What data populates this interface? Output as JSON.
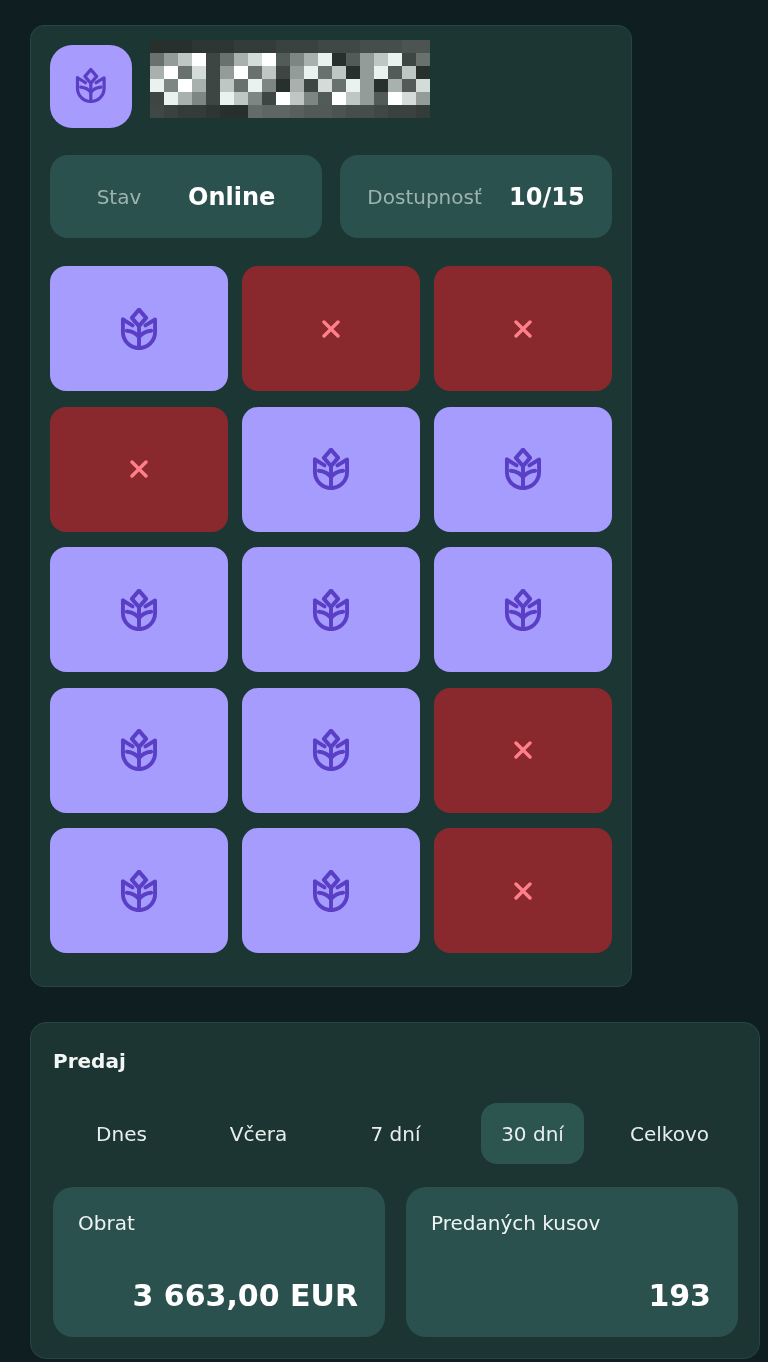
{
  "stats": [
    {
      "label": "Stav",
      "value": "Online"
    },
    {
      "label": "Dostupnosť",
      "value": "10/15"
    }
  ],
  "slots": [
    {
      "available": true
    },
    {
      "available": false
    },
    {
      "available": false
    },
    {
      "available": false
    },
    {
      "available": true
    },
    {
      "available": true
    },
    {
      "available": true
    },
    {
      "available": true
    },
    {
      "available": true
    },
    {
      "available": true
    },
    {
      "available": true
    },
    {
      "available": false
    },
    {
      "available": true
    },
    {
      "available": true
    },
    {
      "available": false
    }
  ],
  "sales": {
    "title": "Predaj",
    "periods": [
      {
        "label": "Dnes",
        "selected": false
      },
      {
        "label": "Včera",
        "selected": false
      },
      {
        "label": "7 dní",
        "selected": false
      },
      {
        "label": "30 dní",
        "selected": true
      },
      {
        "label": "Celkovo",
        "selected": false
      }
    ],
    "metrics": [
      {
        "label": "Obrat",
        "value": "3 663,00 EUR"
      },
      {
        "label": "Predaných kusov",
        "value": "193"
      }
    ]
  }
}
